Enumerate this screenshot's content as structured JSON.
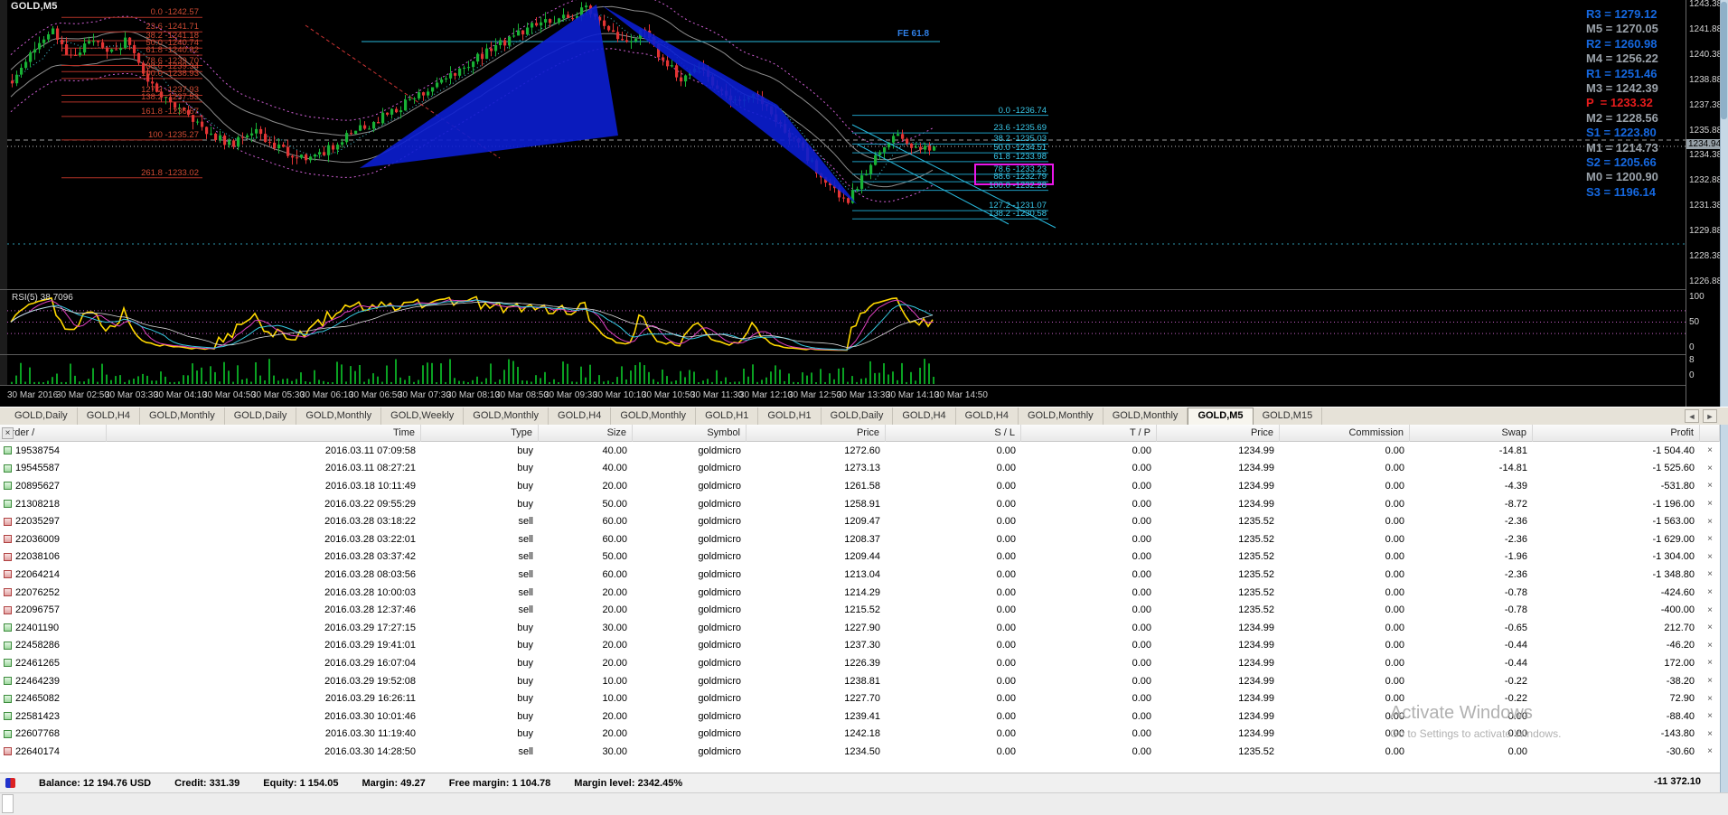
{
  "chart": {
    "symbol_label": "GOLD,M5",
    "fe_label": "FE 61.8",
    "current_price_tag": "1234.94",
    "price_axis_labels": [
      {
        "text": "1243.38",
        "price": 1243.38
      },
      {
        "text": "1241.88",
        "price": 1241.88
      },
      {
        "text": "1240.38",
        "price": 1240.38
      },
      {
        "text": "1238.88",
        "price": 1238.88
      },
      {
        "text": "1237.38",
        "price": 1237.38
      },
      {
        "text": "1235.88",
        "price": 1235.88
      },
      {
        "text": "1234.38",
        "price": 1234.38
      },
      {
        "text": "1232.88",
        "price": 1232.88
      },
      {
        "text": "1231.38",
        "price": 1231.38
      },
      {
        "text": "1229.88",
        "price": 1229.88
      },
      {
        "text": "1228.38",
        "price": 1228.38
      },
      {
        "text": "1226.88",
        "price": 1226.88
      }
    ],
    "pivots": [
      {
        "text": "R3 = 1279.12",
        "color": "blue"
      },
      {
        "text": "M5 = 1270.05",
        "color": "gray"
      },
      {
        "text": "R2 = 1260.98",
        "color": "blue"
      },
      {
        "text": "M4 = 1256.22",
        "color": "gray"
      },
      {
        "text": "R1 = 1251.46",
        "color": "blue"
      },
      {
        "text": "M3 = 1242.39",
        "color": "gray"
      },
      {
        "text": "P  = 1233.32",
        "color": "red"
      },
      {
        "text": "M2 = 1228.56",
        "color": "gray"
      },
      {
        "text": "S1 = 1223.80",
        "color": "blue"
      },
      {
        "text": "M1 = 1214.73",
        "color": "gray"
      },
      {
        "text": "S2 = 1205.66",
        "color": "blue"
      },
      {
        "text": "M0 = 1200.90",
        "color": "gray"
      },
      {
        "text": "S3 = 1196.14",
        "color": "blue"
      }
    ],
    "fib_left": [
      {
        "text": "0.0 -1242.57",
        "price": 1242.57
      },
      {
        "text": "23.6 -1241.71",
        "price": 1241.71
      },
      {
        "text": "38.2 -1241.18",
        "price": 1241.18
      },
      {
        "text": "50.0 -1240.74",
        "price": 1240.74
      },
      {
        "text": "61.8 -1240.32",
        "price": 1240.32
      },
      {
        "text": "78.6 -1239.70",
        "price": 1239.7
      },
      {
        "text": "88.6 -1239.34",
        "price": 1239.34
      },
      {
        "text": "100.0 -1238.93",
        "price": 1238.93
      },
      {
        "text": "127.2 -1237.93",
        "price": 1237.93
      },
      {
        "text": "138.2 -1237.53",
        "price": 1237.53
      },
      {
        "text": "161.8 -1236.67",
        "price": 1236.67
      },
      {
        "text": "100 -1235.27",
        "price": 1235.27
      },
      {
        "text": "261.8 -1233.02",
        "price": 1233.02
      }
    ],
    "fib_right": [
      {
        "text": "0.0 -1236.74",
        "price": 1236.74,
        "boxed": false
      },
      {
        "text": "23.6 -1235.69",
        "price": 1235.69,
        "boxed": false
      },
      {
        "text": "38.2 -1235.03",
        "price": 1235.03,
        "boxed": false
      },
      {
        "text": "50.0 -1234.51",
        "price": 1234.51,
        "boxed": false
      },
      {
        "text": "61.8 -1233.98",
        "price": 1233.98,
        "boxed": false
      },
      {
        "text": "78.6 -1233.23",
        "price": 1233.23,
        "boxed": true
      },
      {
        "text": "88.6 -1232.79",
        "price": 1232.79,
        "boxed": true
      },
      {
        "text": "100.0 -1232.28",
        "price": 1232.28,
        "boxed": false
      },
      {
        "text": "127.2 -1231.07",
        "price": 1231.07,
        "boxed": false
      },
      {
        "text": "138.2 -1230.58",
        "price": 1230.58,
        "boxed": false
      }
    ],
    "anchors": [
      [
        0,
        1238.8
      ],
      [
        0.02,
        1240.6
      ],
      [
        0.045,
        1241.7
      ],
      [
        0.065,
        1240.1
      ],
      [
        0.085,
        1241.3
      ],
      [
        0.105,
        1240.6
      ],
      [
        0.125,
        1241.2
      ],
      [
        0.145,
        1239.0
      ],
      [
        0.17,
        1237.5
      ],
      [
        0.2,
        1236.3
      ],
      [
        0.235,
        1235.0
      ],
      [
        0.265,
        1235.7
      ],
      [
        0.3,
        1234.5
      ],
      [
        0.33,
        1234.2
      ],
      [
        0.36,
        1235.4
      ],
      [
        0.4,
        1236.6
      ],
      [
        0.44,
        1237.9
      ],
      [
        0.48,
        1239.3
      ],
      [
        0.52,
        1240.7
      ],
      [
        0.56,
        1242.0
      ],
      [
        0.6,
        1242.6
      ],
      [
        0.625,
        1243.1
      ],
      [
        0.645,
        1242.1
      ],
      [
        0.665,
        1241.0
      ],
      [
        0.685,
        1241.7
      ],
      [
        0.705,
        1240.1
      ],
      [
        0.725,
        1238.9
      ],
      [
        0.745,
        1239.5
      ],
      [
        0.765,
        1238.2
      ],
      [
        0.785,
        1237.4
      ],
      [
        0.805,
        1238.0
      ],
      [
        0.825,
        1236.7
      ],
      [
        0.845,
        1235.4
      ],
      [
        0.865,
        1234.1
      ],
      [
        0.885,
        1232.5
      ],
      [
        0.905,
        1231.5
      ],
      [
        0.925,
        1233.3
      ],
      [
        0.945,
        1234.9
      ],
      [
        0.962,
        1235.6
      ],
      [
        0.978,
        1234.6
      ],
      [
        1,
        1234.9
      ]
    ],
    "colors": {
      "up": "#18b135",
      "down": "#e23434",
      "triangle": "#0b1ed2",
      "fib_left_line": "#b23227",
      "fib_right_line": "#1e9cc0",
      "box": "#ea16ea"
    }
  },
  "rsi": {
    "label": "RSI(5) 38.7096",
    "scale": [
      "100",
      "50",
      "0"
    ]
  },
  "volume": {
    "scale": [
      "8",
      "0"
    ]
  },
  "time_axis": [
    "30 Mar 2016",
    "30 Mar 02:50",
    "30 Mar 03:30",
    "30 Mar 04:10",
    "30 Mar 04:50",
    "30 Mar 05:30",
    "30 Mar 06:10",
    "30 Mar 06:50",
    "30 Mar 07:30",
    "30 Mar 08:10",
    "30 Mar 08:50",
    "30 Mar 09:30",
    "30 Mar 10:10",
    "30 Mar 10:50",
    "30 Mar 11:30",
    "30 Mar 12:10",
    "30 Mar 12:50",
    "30 Mar 13:30",
    "30 Mar 14:10",
    "30 Mar 14:50"
  ],
  "tabs": {
    "items": [
      "GOLD,Daily",
      "GOLD,H4",
      "GOLD,Monthly",
      "GOLD,Daily",
      "GOLD,Monthly",
      "GOLD,Weekly",
      "GOLD,Monthly",
      "GOLD,H4",
      "GOLD,Monthly",
      "GOLD,H1",
      "GOLD,H1",
      "GOLD,Daily",
      "GOLD,H4",
      "GOLD,H4",
      "GOLD,Monthly",
      "GOLD,Monthly",
      "GOLD,M5",
      "GOLD,M15"
    ],
    "active_index": 16,
    "scroll_left": "◄",
    "scroll_right": "►"
  },
  "toolbox": {
    "close_symbol": "×",
    "row_close_symbol": "×"
  },
  "table": {
    "headers": [
      "Order /",
      "Time",
      "Type",
      "Size",
      "Symbol",
      "Price",
      "S / L",
      "T / P",
      "Price",
      "Commission",
      "Swap",
      "Profit"
    ],
    "rows": [
      {
        "order": "19538754",
        "time": "2016.03.11 07:09:58",
        "type": "buy",
        "size": "40.00",
        "symbol": "goldmicro",
        "price": "1272.60",
        "sl": "0.00",
        "tp": "0.00",
        "price2": "1234.99",
        "commission": "0.00",
        "swap": "-14.81",
        "profit": "-1 504.40"
      },
      {
        "order": "19545587",
        "time": "2016.03.11 08:27:21",
        "type": "buy",
        "size": "40.00",
        "symbol": "goldmicro",
        "price": "1273.13",
        "sl": "0.00",
        "tp": "0.00",
        "price2": "1234.99",
        "commission": "0.00",
        "swap": "-14.81",
        "profit": "-1 525.60"
      },
      {
        "order": "20895627",
        "time": "2016.03.18 10:11:49",
        "type": "buy",
        "size": "20.00",
        "symbol": "goldmicro",
        "price": "1261.58",
        "sl": "0.00",
        "tp": "0.00",
        "price2": "1234.99",
        "commission": "0.00",
        "swap": "-4.39",
        "profit": "-531.80"
      },
      {
        "order": "21308218",
        "time": "2016.03.22 09:55:29",
        "type": "buy",
        "size": "50.00",
        "symbol": "goldmicro",
        "price": "1258.91",
        "sl": "0.00",
        "tp": "0.00",
        "price2": "1234.99",
        "commission": "0.00",
        "swap": "-8.72",
        "profit": "-1 196.00"
      },
      {
        "order": "22035297",
        "time": "2016.03.28 03:18:22",
        "type": "sell",
        "size": "60.00",
        "symbol": "goldmicro",
        "price": "1209.47",
        "sl": "0.00",
        "tp": "0.00",
        "price2": "1235.52",
        "commission": "0.00",
        "swap": "-2.36",
        "profit": "-1 563.00"
      },
      {
        "order": "22036009",
        "time": "2016.03.28 03:22:01",
        "type": "sell",
        "size": "60.00",
        "symbol": "goldmicro",
        "price": "1208.37",
        "sl": "0.00",
        "tp": "0.00",
        "price2": "1235.52",
        "commission": "0.00",
        "swap": "-2.36",
        "profit": "-1 629.00"
      },
      {
        "order": "22038106",
        "time": "2016.03.28 03:37:42",
        "type": "sell",
        "size": "50.00",
        "symbol": "goldmicro",
        "price": "1209.44",
        "sl": "0.00",
        "tp": "0.00",
        "price2": "1235.52",
        "commission": "0.00",
        "swap": "-1.96",
        "profit": "-1 304.00"
      },
      {
        "order": "22064214",
        "time": "2016.03.28 08:03:56",
        "type": "sell",
        "size": "60.00",
        "symbol": "goldmicro",
        "price": "1213.04",
        "sl": "0.00",
        "tp": "0.00",
        "price2": "1235.52",
        "commission": "0.00",
        "swap": "-2.36",
        "profit": "-1 348.80"
      },
      {
        "order": "22076252",
        "time": "2016.03.28 10:00:03",
        "type": "sell",
        "size": "20.00",
        "symbol": "goldmicro",
        "price": "1214.29",
        "sl": "0.00",
        "tp": "0.00",
        "price2": "1235.52",
        "commission": "0.00",
        "swap": "-0.78",
        "profit": "-424.60"
      },
      {
        "order": "22096757",
        "time": "2016.03.28 12:37:46",
        "type": "sell",
        "size": "20.00",
        "symbol": "goldmicro",
        "price": "1215.52",
        "sl": "0.00",
        "tp": "0.00",
        "price2": "1235.52",
        "commission": "0.00",
        "swap": "-0.78",
        "profit": "-400.00"
      },
      {
        "order": "22401190",
        "time": "2016.03.29 17:27:15",
        "type": "buy",
        "size": "30.00",
        "symbol": "goldmicro",
        "price": "1227.90",
        "sl": "0.00",
        "tp": "0.00",
        "price2": "1234.99",
        "commission": "0.00",
        "swap": "-0.65",
        "profit": "212.70"
      },
      {
        "order": "22458286",
        "time": "2016.03.29 19:41:01",
        "type": "buy",
        "size": "20.00",
        "symbol": "goldmicro",
        "price": "1237.30",
        "sl": "0.00",
        "tp": "0.00",
        "price2": "1234.99",
        "commission": "0.00",
        "swap": "-0.44",
        "profit": "-46.20"
      },
      {
        "order": "22461265",
        "time": "2016.03.29 16:07:04",
        "type": "buy",
        "size": "20.00",
        "symbol": "goldmicro",
        "price": "1226.39",
        "sl": "0.00",
        "tp": "0.00",
        "price2": "1234.99",
        "commission": "0.00",
        "swap": "-0.44",
        "profit": "172.00"
      },
      {
        "order": "22464239",
        "time": "2016.03.29 19:52:08",
        "type": "buy",
        "size": "10.00",
        "symbol": "goldmicro",
        "price": "1238.81",
        "sl": "0.00",
        "tp": "0.00",
        "price2": "1234.99",
        "commission": "0.00",
        "swap": "-0.22",
        "profit": "-38.20"
      },
      {
        "order": "22465082",
        "time": "2016.03.29 16:26:11",
        "type": "buy",
        "size": "10.00",
        "symbol": "goldmicro",
        "price": "1227.70",
        "sl": "0.00",
        "tp": "0.00",
        "price2": "1234.99",
        "commission": "0.00",
        "swap": "-0.22",
        "profit": "72.90"
      },
      {
        "order": "22581423",
        "time": "2016.03.30 10:01:46",
        "type": "buy",
        "size": "20.00",
        "symbol": "goldmicro",
        "price": "1239.41",
        "sl": "0.00",
        "tp": "0.00",
        "price2": "1234.99",
        "commission": "0.00",
        "swap": "0.00",
        "profit": "-88.40"
      },
      {
        "order": "22607768",
        "time": "2016.03.30 11:19:40",
        "type": "buy",
        "size": "20.00",
        "symbol": "goldmicro",
        "price": "1242.18",
        "sl": "0.00",
        "tp": "0.00",
        "price2": "1234.99",
        "commission": "0.00",
        "swap": "0.00",
        "profit": "-143.80"
      },
      {
        "order": "22640174",
        "time": "2016.03.30 14:28:50",
        "type": "sell",
        "size": "30.00",
        "symbol": "goldmicro",
        "price": "1234.50",
        "sl": "0.00",
        "tp": "0.00",
        "price2": "1235.52",
        "commission": "0.00",
        "swap": "0.00",
        "profit": "-30.60"
      }
    ]
  },
  "status_bar": {
    "balance": "Balance: 12 194.76 USD",
    "credit": "Credit: 331.39",
    "equity": "Equity: 1 154.05",
    "margin": "Margin: 49.27",
    "free_margin": "Free margin: 1 104.78",
    "margin_level": "Margin level: 2342.45%",
    "total_profit": "-11 372.10"
  },
  "watermark": {
    "line1": "Activate Windows",
    "line2": "Go to Settings to activate Windows."
  }
}
